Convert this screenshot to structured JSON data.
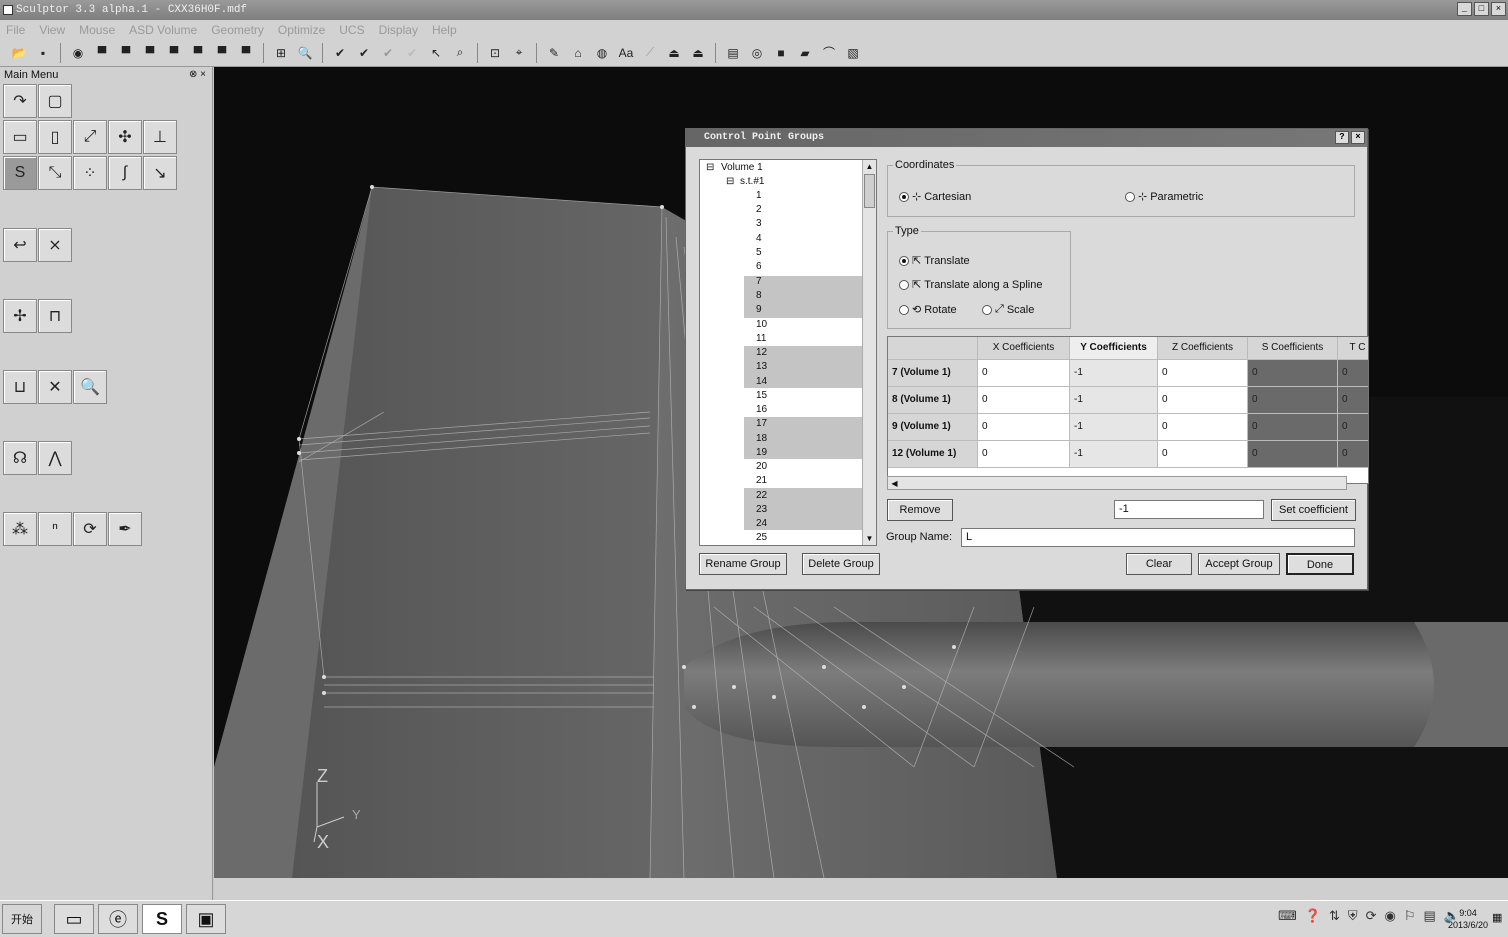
{
  "window": {
    "title": "Sculptor 3.3 alpha.1 - CXX36H0F.mdf",
    "controls": [
      "_",
      "□",
      "×"
    ]
  },
  "menu": [
    "File",
    "View",
    "Mouse",
    "ASD Volume",
    "Geometry",
    "Optimize",
    "UCS",
    "Display",
    "Help"
  ],
  "sidebar": {
    "title": "Main Menu",
    "controls": "⊗ ×"
  },
  "axes": {
    "z": "Z",
    "y": "Y",
    "x": "X"
  },
  "dialog": {
    "title": "Control Point Groups",
    "controls": [
      "?",
      "×"
    ],
    "tree": {
      "root": "Volume 1",
      "group": "s.t.#1",
      "items": [
        "1",
        "2",
        "3",
        "4",
        "5",
        "6",
        "7",
        "8",
        "9",
        "10",
        "11",
        "12",
        "13",
        "14",
        "15",
        "16",
        "17",
        "18",
        "19",
        "20",
        "21",
        "22",
        "23",
        "24",
        "25"
      ]
    },
    "coordinates": {
      "label": "Coordinates",
      "cartesian": "Cartesian",
      "parametric": "Parametric",
      "selected": "Cartesian"
    },
    "type": {
      "label": "Type",
      "translate": "Translate",
      "spline": "Translate along a Spline",
      "rotate": "Rotate",
      "scale": "Scale",
      "selected": "Translate"
    },
    "grid": {
      "headers": [
        "X Coefficients",
        "Y Coefficients",
        "Z Coefficients",
        "S Coefficients",
        "T C"
      ],
      "rows": [
        {
          "label": "7 (Volume 1)",
          "values": [
            "0",
            "-1",
            "0",
            "0",
            "0"
          ]
        },
        {
          "label": "8 (Volume 1)",
          "values": [
            "0",
            "-1",
            "0",
            "0",
            "0"
          ]
        },
        {
          "label": "9 (Volume 1)",
          "values": [
            "0",
            "-1",
            "0",
            "0",
            "0"
          ]
        },
        {
          "label": "12 (Volume 1)",
          "values": [
            "0",
            "-1",
            "0",
            "0",
            "0"
          ]
        }
      ]
    },
    "remove_label": "Remove",
    "coef_value": "-1",
    "set_coef_label": "Set coefficient",
    "group_name_label": "Group Name:",
    "group_name_value": "L",
    "rename_label": "Rename Group",
    "delete_label": "Delete Group",
    "clear_label": "Clear",
    "accept_label": "Accept Group",
    "done_label": "Done"
  },
  "taskbar": {
    "start": "开始",
    "time": "9:04",
    "date": "2013/6/20"
  }
}
